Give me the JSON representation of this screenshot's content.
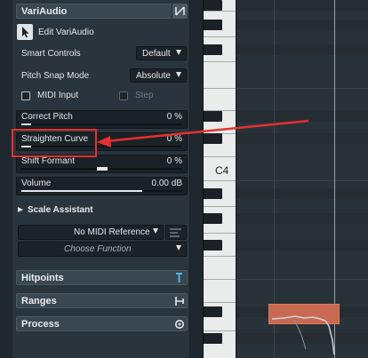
{
  "inspector": {
    "title": "VariAudio",
    "edit_label": "Edit VariAudio",
    "smart_controls": {
      "label": "Smart Controls",
      "value": "Default"
    },
    "pitch_snap": {
      "label": "Pitch Snap Mode",
      "value": "Absolute"
    },
    "midi_input_label": "MIDI Input",
    "step_label": "Step",
    "params": [
      {
        "label": "Correct Pitch",
        "value": "0 %",
        "level": 0.0
      },
      {
        "label": "Straighten Curve",
        "value": "0 %",
        "level": 0.0
      },
      {
        "label": "Shift Formant",
        "value": "0 %",
        "level": 0.5
      },
      {
        "label": "Volume",
        "value": "0.00 dB",
        "level": 0.75
      }
    ],
    "scale_assistant": {
      "label": "Scale Assistant",
      "reference": "No MIDI Reference",
      "choose_function": "Choose Function"
    },
    "sections": [
      {
        "label": "Hitpoints"
      },
      {
        "label": "Ranges"
      },
      {
        "label": "Process"
      }
    ]
  },
  "piano": {
    "c4_label": "C4"
  },
  "colors": {
    "highlight": "#e53030",
    "segment": "#c86a52"
  }
}
